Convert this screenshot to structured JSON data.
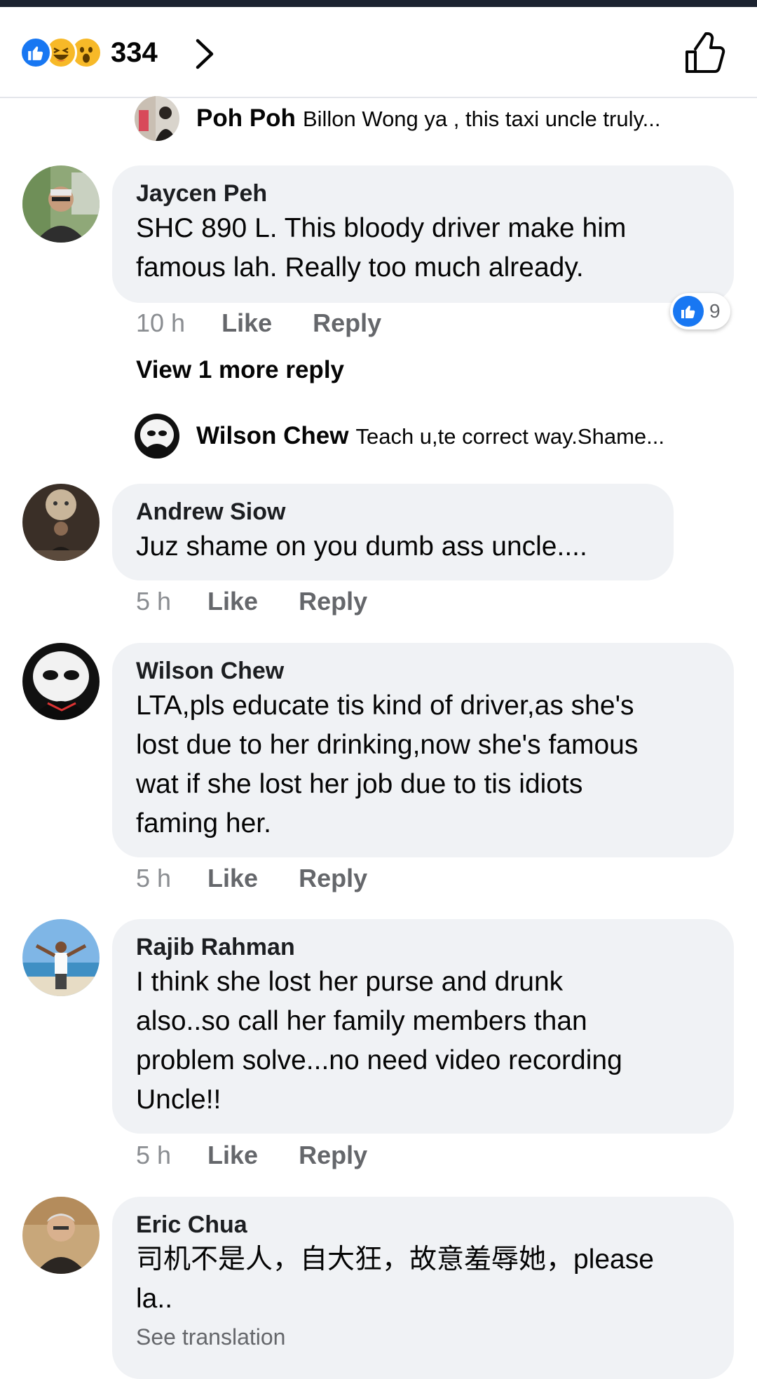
{
  "header": {
    "reaction_count": "334",
    "reaction_icons": [
      "like-icon",
      "haha-icon",
      "wow-icon"
    ]
  },
  "reply_previews": [
    {
      "name": "Poh Poh",
      "text": "Billon Wong ya , this taxi uncle truly..."
    },
    {
      "name": "Wilson Chew",
      "text": "Teach u,te correct way.Shame..."
    }
  ],
  "comments": [
    {
      "author": "Jaycen Peh",
      "lines": [
        "SHC 890 L.  This bloody driver make him",
        "famous lah.  Really too much already."
      ],
      "time": "10 h",
      "like": "Like",
      "reply": "Reply",
      "reaction_count": "9"
    },
    {
      "author": "Andrew Siow",
      "lines": [
        "Juz shame on you dumb ass uncle...."
      ],
      "time": "5 h",
      "like": "Like",
      "reply": "Reply"
    },
    {
      "author": "Wilson Chew",
      "lines": [
        "LTA,pls educate tis kind of driver,as she's",
        "lost due to her drinking,now she's famous",
        "wat if she lost her job due to tis idiots",
        "faming her."
      ],
      "time": "5 h",
      "like": "Like",
      "reply": "Reply"
    },
    {
      "author": "Rajib Rahman",
      "lines": [
        "I think she lost her purse  and drunk",
        "also..so call her family members than",
        "problem solve...no need video recording",
        "Uncle!!"
      ],
      "time": "5 h",
      "like": "Like",
      "reply": "Reply"
    },
    {
      "author": "Eric Chua",
      "lines": [
        "司机不是人，自大狂，故意羞辱她，please",
        "la.."
      ],
      "translation": "See translation"
    }
  ],
  "view_more_replies": "View 1 more reply",
  "colors": {
    "facebook_blue": "#1877f2",
    "bubble": "#f0f2f5",
    "secondary_text": "#65676b"
  }
}
